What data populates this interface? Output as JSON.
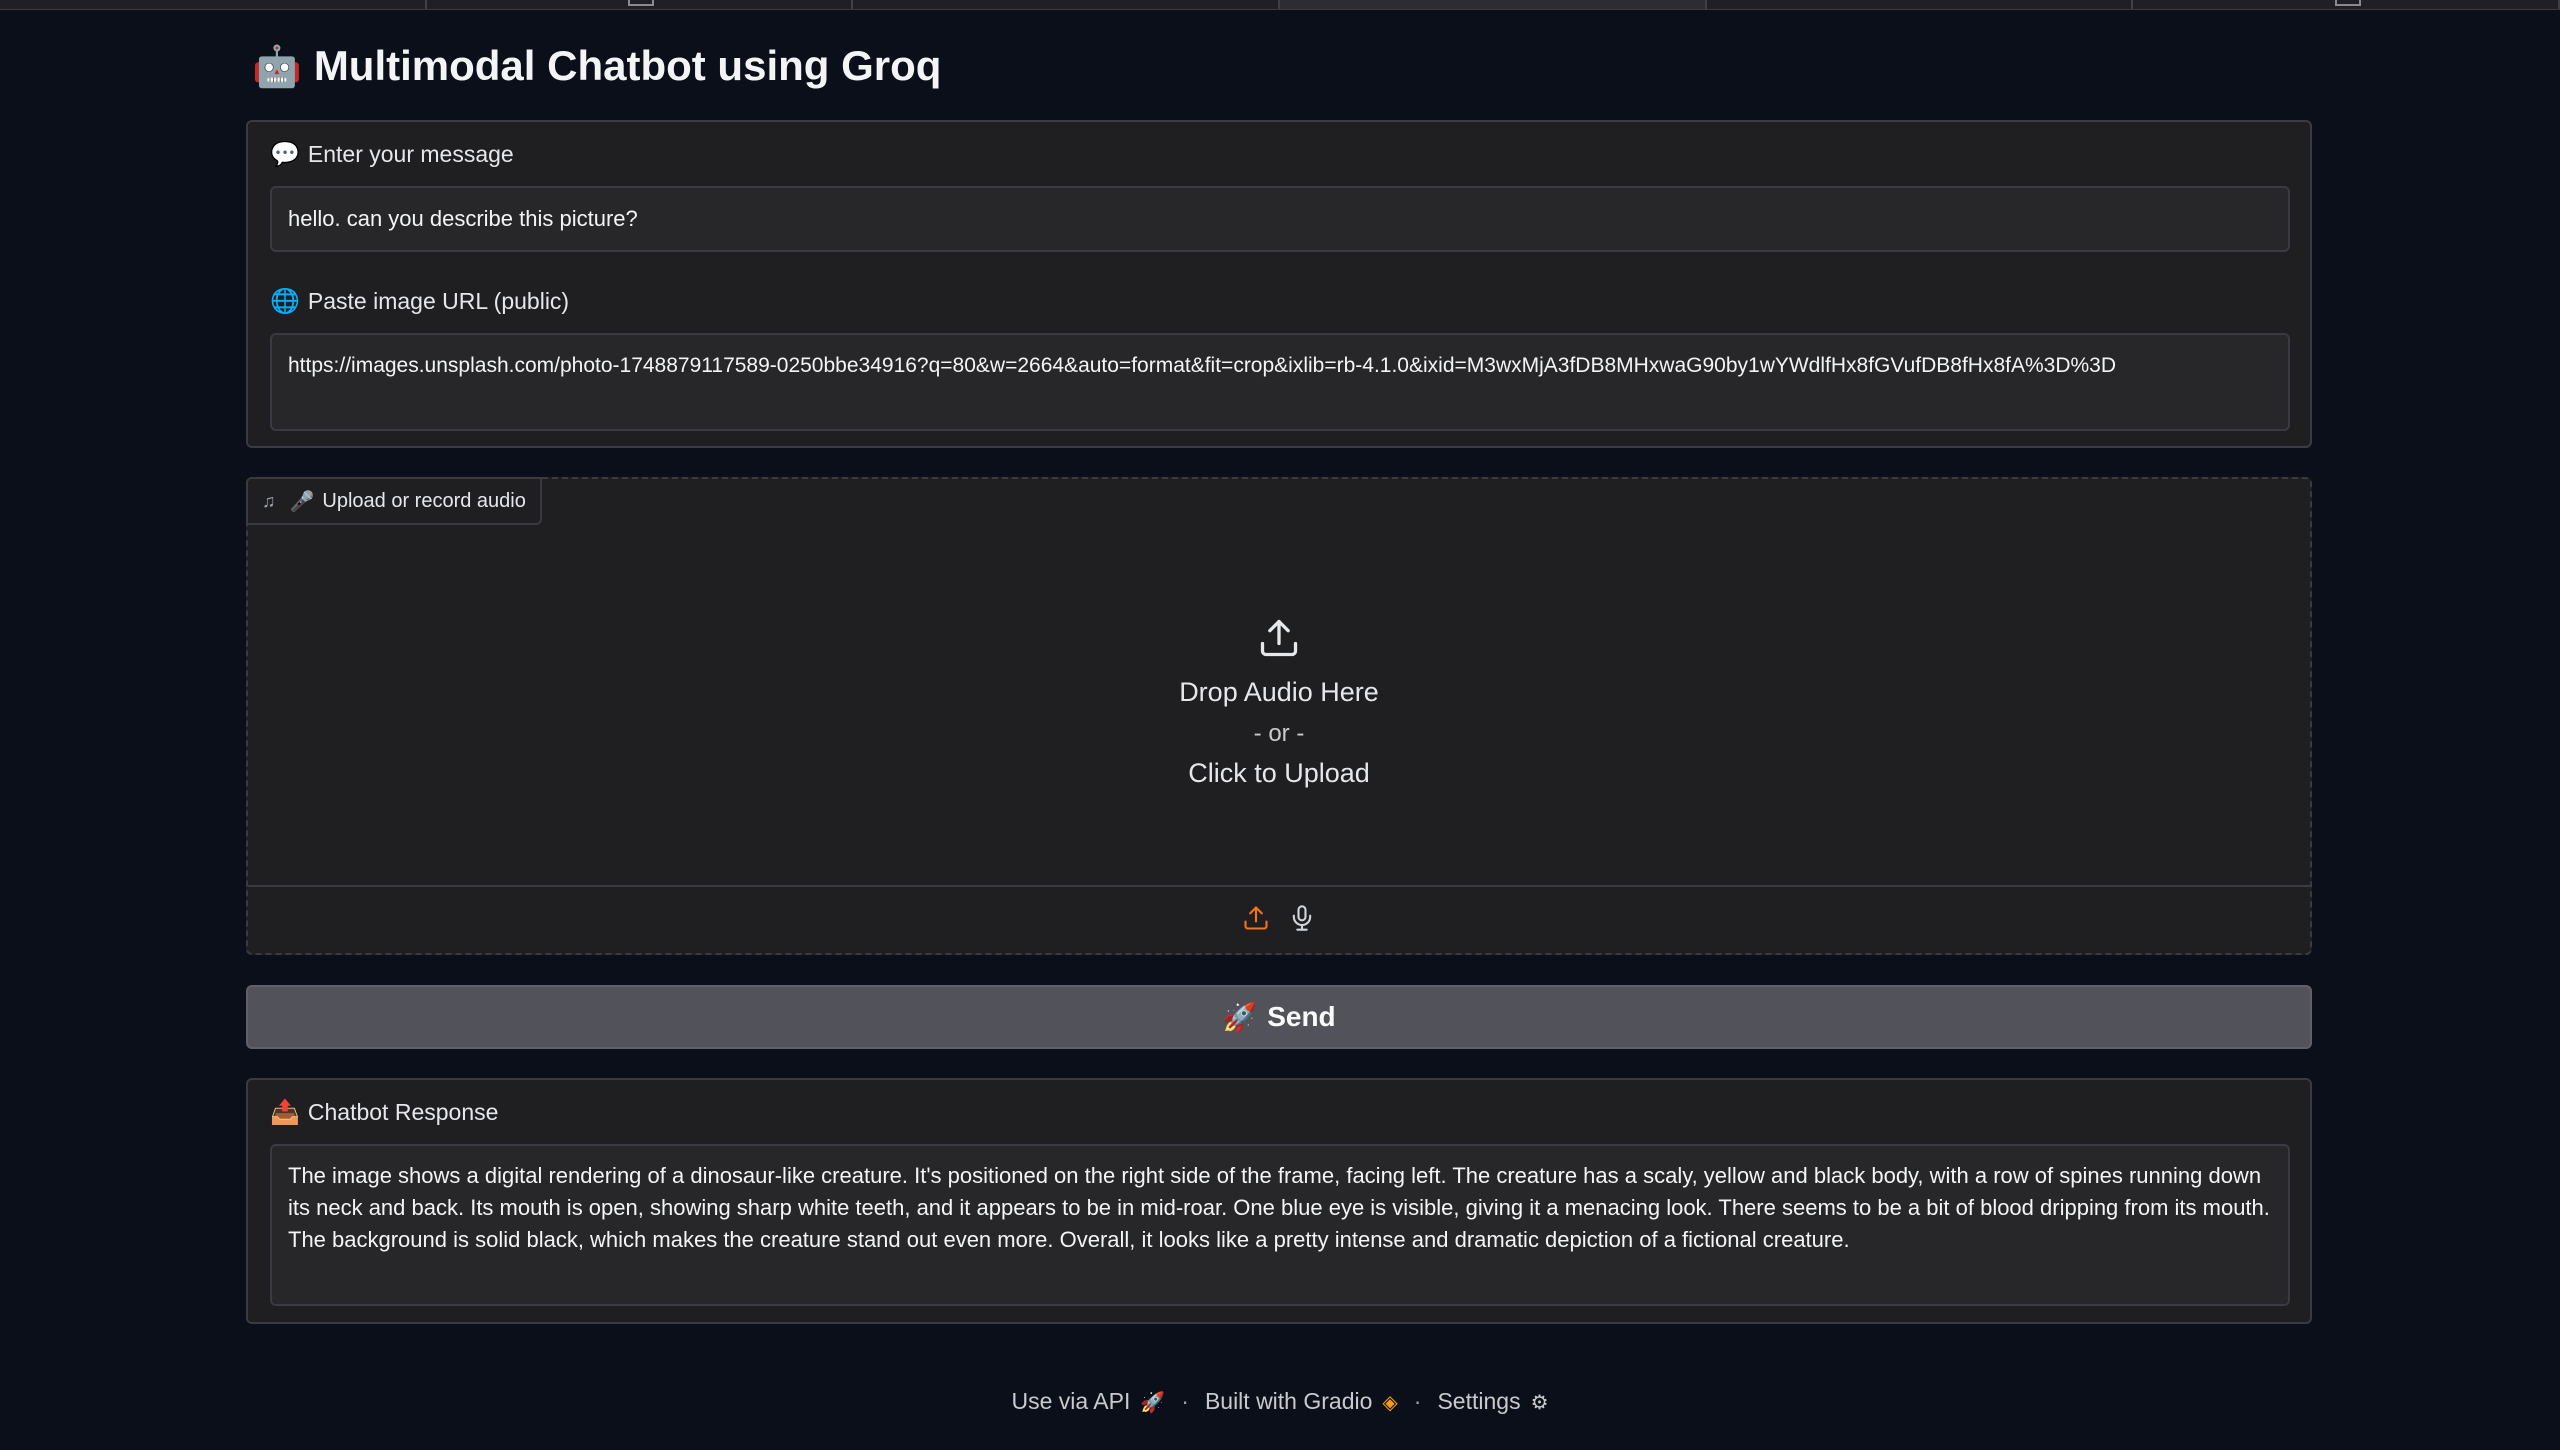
{
  "title": {
    "emoji": "🤖",
    "text": "Multimodal Chatbot using Groq"
  },
  "message": {
    "emoji": "💬",
    "label": "Enter your message",
    "value": "hello. can you describe this picture?"
  },
  "image_url": {
    "emoji": "🌐",
    "label": "Paste image URL (public)",
    "value": "https://images.unsplash.com/photo-1748879117589-0250bbe34916?q=80&w=2664&auto=format&fit=crop&ixlib=rb-4.1.0&ixid=M3wxMjA3fDB8MHxwaG90by1wYWdlfHx8fGVufDB8fHx8fA%3D%3D"
  },
  "audio": {
    "tag_emoji": "🎤",
    "tag_label": "Upload or record audio",
    "drop_text": "Drop Audio Here",
    "or_text": "- or -",
    "click_text": "Click to Upload"
  },
  "send": {
    "emoji": "🚀",
    "label": "Send"
  },
  "response": {
    "emoji": "📤",
    "label": "Chatbot Response",
    "value": "The image shows a digital rendering of a dinosaur-like creature. It's positioned on the right side of the frame, facing left. The creature has a scaly, yellow and black body, with a row of spines running down its neck and back. Its mouth is open, showing sharp white teeth, and it appears to be in mid-roar. One blue eye is visible, giving it a menacing look. There seems to be a bit of blood dripping from its mouth. The background is solid black, which makes the creature stand out even more. Overall, it looks like a pretty intense and dramatic depiction of a fictional creature."
  },
  "footer": {
    "api": "Use via API",
    "sep": "·",
    "built": "Built with Gradio",
    "settings": "Settings"
  },
  "colors": {
    "background": "#0b0f19",
    "panel": "#1f1f22",
    "accent_orange": "#f97316",
    "send_button": "#52525b"
  }
}
